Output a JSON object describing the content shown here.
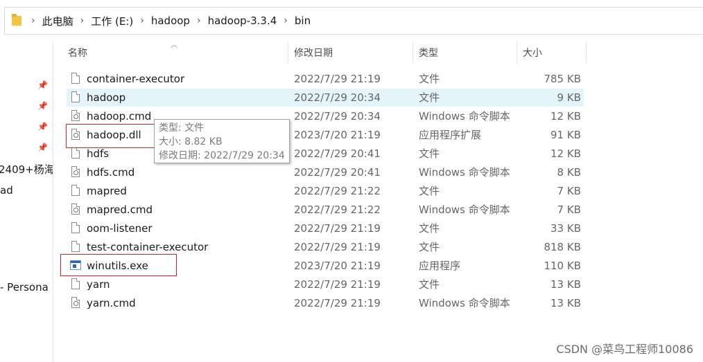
{
  "breadcrumb": [
    "此电脑",
    "工作 (E:)",
    "hadoop",
    "hadoop-3.3.4",
    "bin"
  ],
  "nav": {
    "text1": "2409+杨海",
    "text2": "ad",
    "text3": " - Persona"
  },
  "columns": {
    "name": "名称",
    "date": "修改日期",
    "type": "类型",
    "size": "大小"
  },
  "files": [
    {
      "name": "container-executor",
      "date": "2022/7/29 21:19",
      "type": "文件",
      "size": "785 KB",
      "icon": "file-icon"
    },
    {
      "name": "hadoop",
      "date": "2022/7/29 20:34",
      "type": "文件",
      "size": "9 KB",
      "icon": "file-icon"
    },
    {
      "name": "hadoop.cmd",
      "date": "2022/7/29 20:34",
      "type": "Windows 命令脚本",
      "size": "12 KB",
      "icon": "cmd-file-icon"
    },
    {
      "name": "hadoop.dll",
      "date": "2023/7/20 21:19",
      "type": "应用程序扩展",
      "size": "91 KB",
      "icon": "dll-file-icon"
    },
    {
      "name": "hdfs",
      "date": "2022/7/29 20:41",
      "type": "文件",
      "size": "12 KB",
      "icon": "file-icon"
    },
    {
      "name": "hdfs.cmd",
      "date": "2022/7/29 20:41",
      "type": "Windows 命令脚本",
      "size": "8 KB",
      "icon": "cmd-file-icon"
    },
    {
      "name": "mapred",
      "date": "2022/7/29 21:22",
      "type": "文件",
      "size": "7 KB",
      "icon": "file-icon"
    },
    {
      "name": "mapred.cmd",
      "date": "2022/7/29 21:22",
      "type": "Windows 命令脚本",
      "size": "7 KB",
      "icon": "cmd-file-icon"
    },
    {
      "name": "oom-listener",
      "date": "2022/7/29 21:19",
      "type": "文件",
      "size": "33 KB",
      "icon": "file-icon"
    },
    {
      "name": "test-container-executor",
      "date": "2022/7/29 21:19",
      "type": "文件",
      "size": "818 KB",
      "icon": "file-icon"
    },
    {
      "name": "winutils.exe",
      "date": "2023/7/20 21:19",
      "type": "应用程序",
      "size": "110 KB",
      "icon": "exe-icon"
    },
    {
      "name": "yarn",
      "date": "2022/7/29 21:19",
      "type": "文件",
      "size": "13 KB",
      "icon": "file-icon"
    },
    {
      "name": "yarn.cmd",
      "date": "2022/7/29 21:19",
      "type": "Windows 命令脚本",
      "size": "13 KB",
      "icon": "cmd-file-icon"
    }
  ],
  "tooltip": {
    "type_line": "类型: 文件",
    "size_line": "大小: 8.82 KB",
    "date_line": "修改日期: 2022/7/29 20:34"
  },
  "watermark": "CSDN @菜鸟工程师10086",
  "colors": {
    "hover_row": "#e5f3fb",
    "highlight_box": "#e02020",
    "folder": "#f4c542"
  }
}
